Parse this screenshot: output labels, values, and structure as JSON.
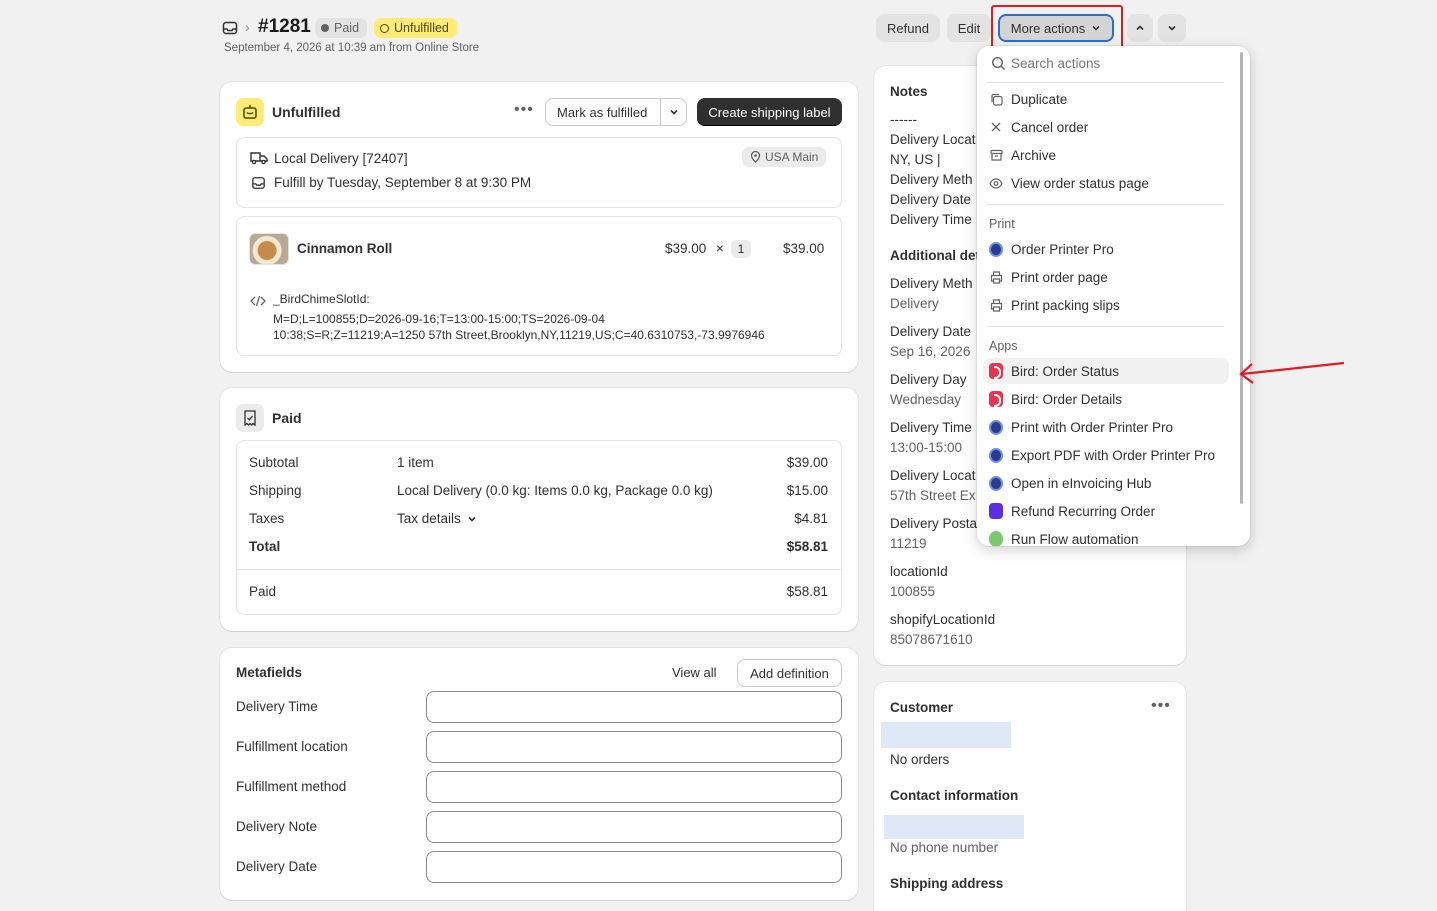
{
  "header": {
    "order_number": "#1281",
    "badge_paid": "Paid",
    "badge_unfulfilled": "Unfulfilled",
    "subtitle": "September 4, 2026 at 10:39 am from Online Store",
    "refund": "Refund",
    "edit": "Edit",
    "more_actions": "More actions"
  },
  "fulfillment": {
    "title": "Unfulfilled",
    "mark_fulfilled": "Mark as fulfilled",
    "create_label": "Create shipping label",
    "delivery_method": "Local Delivery [72407]",
    "fulfill_by": "Fulfill by Tuesday, September 8 at 9:30 PM",
    "location": "USA Main",
    "item_name": "Cinnamon Roll",
    "item_price": "$39.00",
    "times": "×",
    "item_qty": "1",
    "item_total": "$39.00",
    "prop_key": "_BirdChimeSlotId:",
    "prop_line1": "M=D;L=100855;D=2026-09-16;T=13:00-15:00;TS=2026-09-04",
    "prop_line2": "10:38;S=R;Z=11219;A=1250 57th Street,Brooklyn,NY,11219,US;C=40.6310753,-73.9976946"
  },
  "payment": {
    "title": "Paid",
    "rows": [
      {
        "label": "Subtotal",
        "desc": "1 item",
        "amount": "$39.00"
      },
      {
        "label": "Shipping",
        "desc": "Local Delivery (0.0 kg: Items 0.0 kg, Package 0.0 kg)",
        "amount": "$15.00"
      },
      {
        "label": "Taxes",
        "desc": "Tax details",
        "amount": "$4.81"
      },
      {
        "label": "Total",
        "desc": "",
        "amount": "$58.81"
      }
    ],
    "paid_label": "Paid",
    "paid_amount": "$58.81"
  },
  "metafields": {
    "title": "Metafields",
    "view_all": "View all",
    "add_definition": "Add definition",
    "fields": [
      "Delivery Time",
      "Fulfillment location",
      "Fulfillment method",
      "Delivery Note",
      "Delivery Date"
    ]
  },
  "notes": {
    "title": "Notes",
    "lines": [
      "------",
      "Delivery Locat",
      "NY, US |",
      "Delivery Meth",
      "Delivery Date",
      "Delivery Time"
    ],
    "additional_title": "Additional det",
    "details": [
      {
        "key": "Delivery Meth",
        "value": "Delivery"
      },
      {
        "key": "Delivery Date",
        "value": "Sep 16, 2026"
      },
      {
        "key": "Delivery Day",
        "value": "Wednesday"
      },
      {
        "key": "Delivery Time",
        "value": "13:00-15:00"
      },
      {
        "key": "Delivery Locat",
        "value": "57th Street Ex"
      },
      {
        "key": "Delivery Posta",
        "value": "11219"
      },
      {
        "key": "locationId",
        "value": "100855"
      },
      {
        "key": "shopifyLocationId",
        "value": "85078671610"
      }
    ]
  },
  "customer": {
    "title": "Customer",
    "orders": "No orders",
    "contact_title": "Contact information",
    "phone": "No phone number",
    "shipping_title": "Shipping address"
  },
  "dropdown": {
    "search_placeholder": "Search actions",
    "actions": [
      "Duplicate",
      "Cancel order",
      "Archive",
      "View order status page"
    ],
    "print_section": "Print",
    "print_items": [
      "Order Printer Pro",
      "Print order page",
      "Print packing slips"
    ],
    "apps_section": "Apps",
    "app_items": [
      "Bird: Order Status",
      "Bird: Order Details",
      "Print with Order Printer Pro",
      "Export PDF with Order Printer Pro",
      "Open in eInvoicing Hub",
      "Refund Recurring Order",
      "Run Flow automation"
    ]
  }
}
